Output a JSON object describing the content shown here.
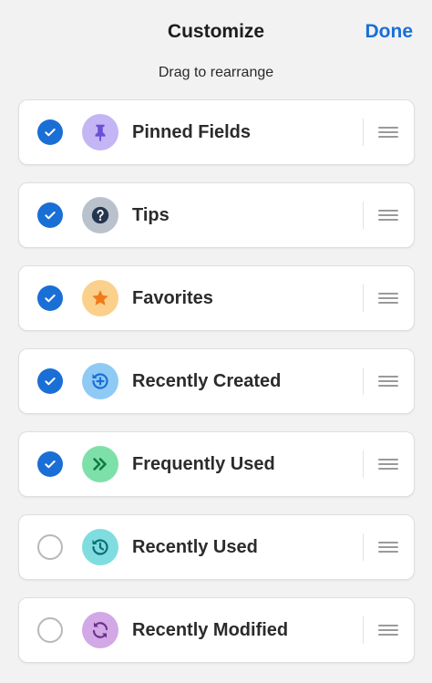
{
  "header": {
    "title": "Customize",
    "done_label": "Done",
    "subtitle": "Drag to rearrange"
  },
  "colors": {
    "accent": "#1a6fd6",
    "background": "#f2f2f2"
  },
  "items": [
    {
      "label": "Pinned Fields",
      "checked": true,
      "icon": "pin-icon",
      "icon_bg": "#c4b5f5",
      "icon_fg": "#6a4fd8"
    },
    {
      "label": "Tips",
      "checked": true,
      "icon": "question-icon",
      "icon_bg": "#b9c2cc",
      "icon_fg": "#23364d"
    },
    {
      "label": "Favorites",
      "checked": true,
      "icon": "star-icon",
      "icon_bg": "#fbd08a",
      "icon_fg": "#f07a1a"
    },
    {
      "label": "Recently Created",
      "checked": true,
      "icon": "recent-add-icon",
      "icon_bg": "#8fcaf4",
      "icon_fg": "#1a6fd6"
    },
    {
      "label": "Frequently Used",
      "checked": true,
      "icon": "fast-forward-icon",
      "icon_bg": "#7de0a8",
      "icon_fg": "#0f7a3e"
    },
    {
      "label": "Recently Used",
      "checked": false,
      "icon": "history-icon",
      "icon_bg": "#7fdde0",
      "icon_fg": "#0e6e77"
    },
    {
      "label": "Recently Modified",
      "checked": false,
      "icon": "refresh-icon",
      "icon_bg": "#d2a8e6",
      "icon_fg": "#6a2f8a"
    }
  ]
}
